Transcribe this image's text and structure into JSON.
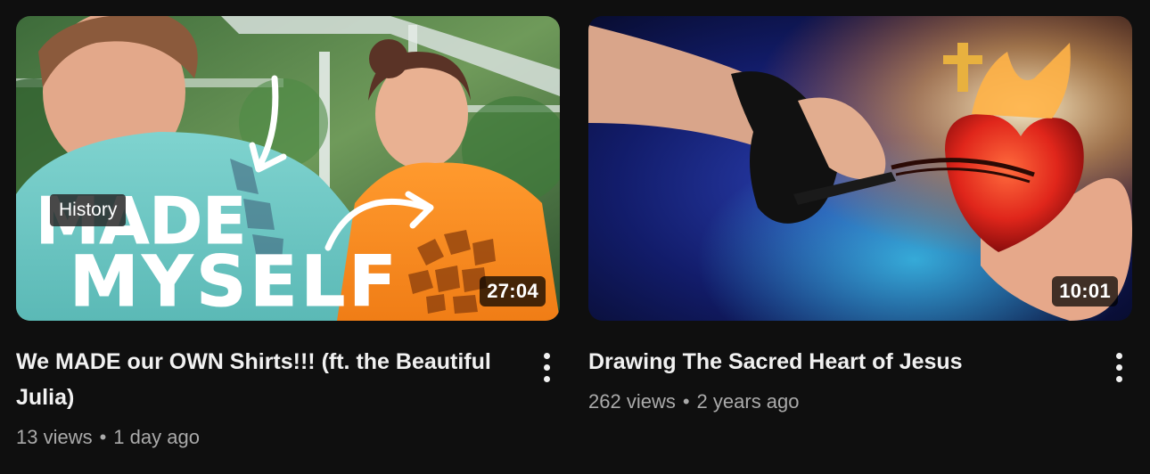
{
  "videos": [
    {
      "title": "We MADE our OWN Shirts!!! (ft. the Beautiful Julia)",
      "duration": "27:04",
      "badge": "History",
      "views": "13 views",
      "separator": "•",
      "age": "1 day ago",
      "thumbnail_text": [
        "MADE",
        "MYSELF"
      ]
    },
    {
      "title": "Drawing The Sacred Heart of Jesus",
      "duration": "10:01",
      "views": "262 views",
      "separator": "•",
      "age": "2 years ago"
    }
  ],
  "colors": {
    "background": "#0f0f0f",
    "title": "#f1f1f1",
    "meta": "#aaaaaa"
  }
}
